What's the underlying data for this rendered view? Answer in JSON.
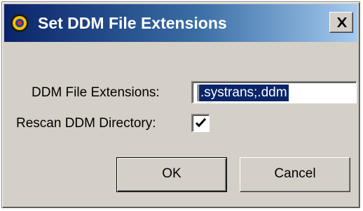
{
  "window": {
    "title": "Set DDM File Extensions",
    "icon": "target-app-icon",
    "close_icon": "close-icon"
  },
  "form": {
    "extensions_label": "DDM File Extensions:",
    "extensions_value": ".systrans;.ddm",
    "rescan_label": "Rescan DDM Directory:",
    "rescan_checked": true
  },
  "buttons": {
    "ok_label": "OK",
    "cancel_label": "Cancel"
  },
  "colors": {
    "titlebar_start": "#0a246a",
    "titlebar_end": "#a6caf0",
    "dialog_face": "#d4d0c8",
    "selection": "#0a246a"
  }
}
